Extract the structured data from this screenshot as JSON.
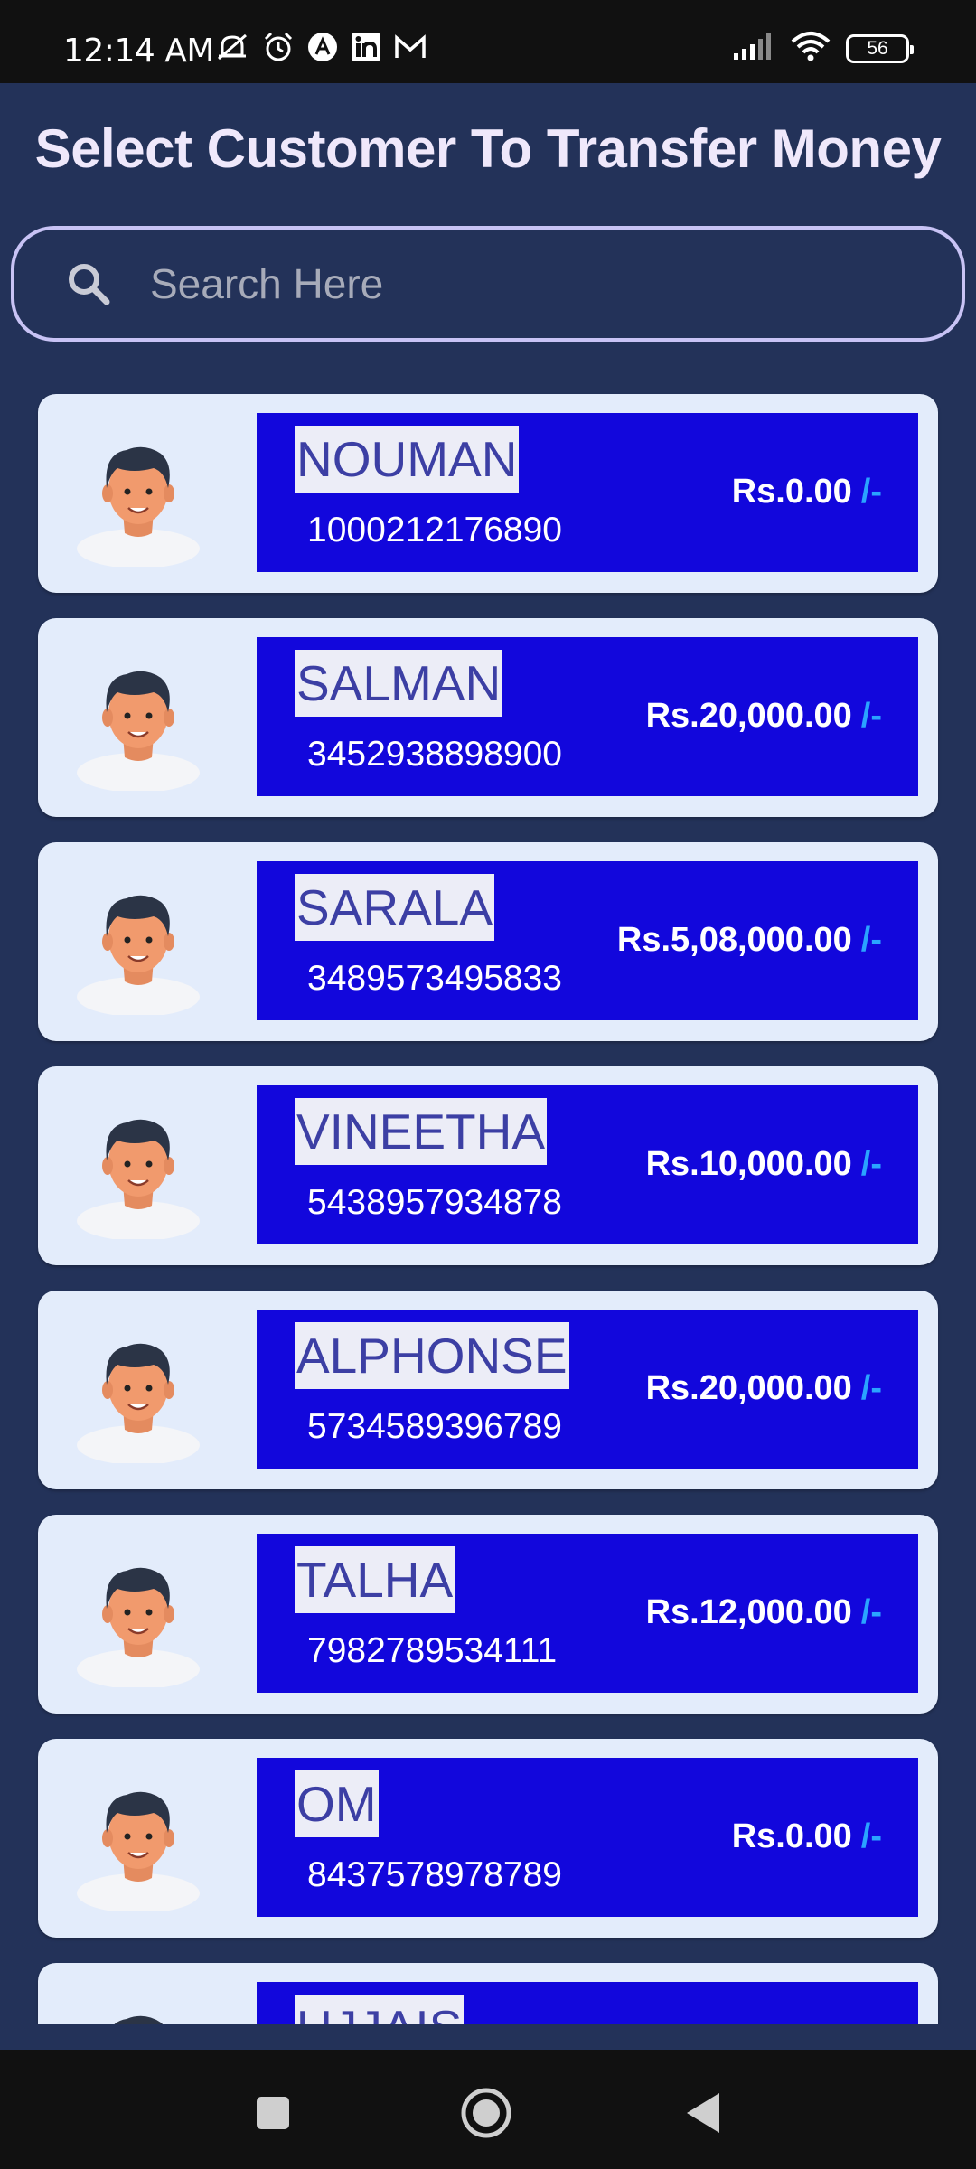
{
  "status_bar": {
    "time": "12:14 AM",
    "battery": "56",
    "left_icons": [
      "mute-icon",
      "alarm-icon",
      "app-icon",
      "linkedin-icon",
      "gmail-icon"
    ],
    "right_icons": [
      "signal-icon",
      "wifi-icon",
      "battery-icon"
    ]
  },
  "page": {
    "title": "Select Customer To Transfer Money"
  },
  "search": {
    "placeholder": "Search Here",
    "icon": "search-icon"
  },
  "customers": [
    {
      "name": "NOUMAN",
      "account": "1000212176890",
      "balance": "Rs.0.00",
      "suffix": "/-"
    },
    {
      "name": "SALMAN",
      "account": "3452938898900",
      "balance": "Rs.20,000.00",
      "suffix": "/-"
    },
    {
      "name": "SARALA",
      "account": "3489573495833",
      "balance": "Rs.5,08,000.00",
      "suffix": "/-"
    },
    {
      "name": "VINEETHA",
      "account": "5438957934878",
      "balance": "Rs.10,000.00",
      "suffix": "/-"
    },
    {
      "name": "ALPHONSE",
      "account": "5734589396789",
      "balance": "Rs.20,000.00",
      "suffix": "/-"
    },
    {
      "name": "TALHA",
      "account": "7982789534111",
      "balance": "Rs.12,000.00",
      "suffix": "/-"
    },
    {
      "name": "OM",
      "account": "8437578978789",
      "balance": "Rs.0.00",
      "suffix": "/-"
    },
    {
      "name": "UJJAIS",
      "account": "",
      "balance": "",
      "suffix": ""
    }
  ],
  "colors": {
    "background": "#233259",
    "card": "#e3ecfb",
    "panel": "#1207dc",
    "accent_suffix": "#2aa4ff",
    "search_border": "#c8c3f5"
  },
  "nav": {
    "icons": [
      "recents-square-icon",
      "home-circle-icon",
      "back-triangle-icon"
    ]
  }
}
